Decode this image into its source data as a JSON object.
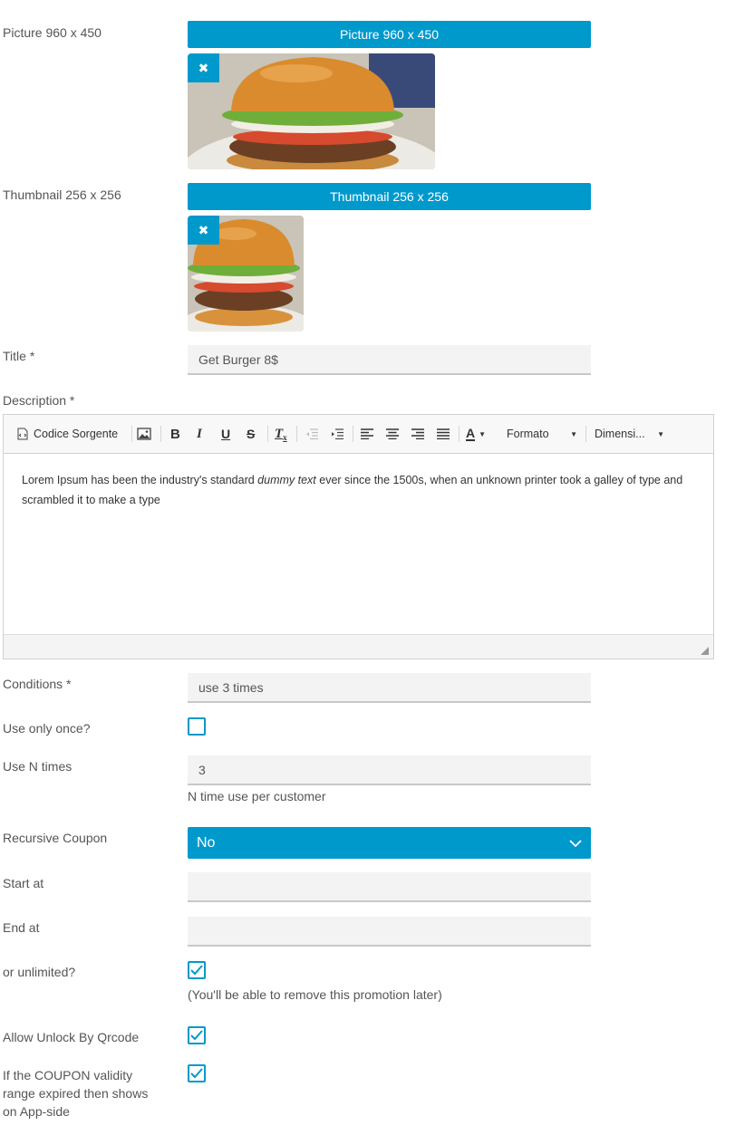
{
  "picture": {
    "label": "Picture 960 x 450",
    "button_label": "Picture 960 x 450",
    "remove_glyph": "✖"
  },
  "thumbnail": {
    "label": "Thumbnail 256 x 256",
    "button_label": "Thumbnail 256 x 256",
    "remove_glyph": "✖"
  },
  "title": {
    "label": "Title *",
    "value": "Get Burger 8$"
  },
  "description": {
    "label": "Description *",
    "toolbar": {
      "source_label": "Codice Sorgente",
      "format_label": "Formato",
      "size_label": "Dimensi...",
      "icons": [
        "source-icon",
        "image-icon",
        "bold-icon",
        "italic-icon",
        "underline-icon",
        "strikethrough-icon",
        "clear-format-icon",
        "outdent-icon",
        "indent-icon",
        "align-left-icon",
        "align-center-icon",
        "align-right-icon",
        "align-justify-icon",
        "text-color-icon"
      ]
    },
    "content": {
      "before": "Lorem Ipsum has been the industry's standard ",
      "italic": "dummy text",
      "after": " ever since the 1500s, when an unknown printer took a galley of type and scrambled it to make a type"
    }
  },
  "conditions": {
    "label": "Conditions *",
    "value": "use 3 times"
  },
  "use_only_once": {
    "label": "Use only once?",
    "checked": false
  },
  "use_n_times": {
    "label": "Use N times",
    "value": "3",
    "help": "N time use per customer"
  },
  "recursive_coupon": {
    "label": "Recursive Coupon",
    "value": "No"
  },
  "start_at": {
    "label": "Start at",
    "value": ""
  },
  "end_at": {
    "label": "End at",
    "value": ""
  },
  "unlimited": {
    "label": "or unlimited?",
    "checked": true,
    "help": "(You'll be able to remove this promotion later)"
  },
  "allow_unlock": {
    "label": "Allow Unlock By Qrcode",
    "checked": true
  },
  "expired_show": {
    "label": "If the COUPON validity range expired then shows on App-side",
    "checked": true
  },
  "colors": {
    "accent": "#0099cc",
    "field_bg": "#f3f3f3",
    "text": "#555555"
  }
}
